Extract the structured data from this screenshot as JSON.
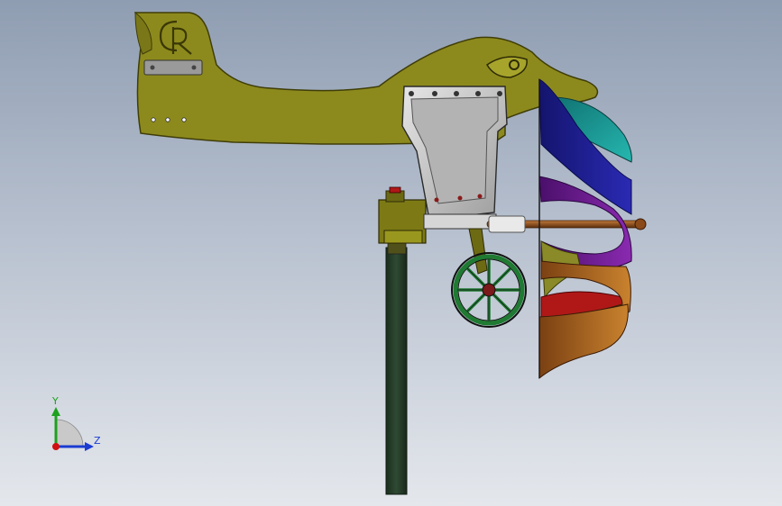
{
  "viewport": {
    "background_top": "#8f9db2",
    "background_bottom": "#e4e7ec"
  },
  "model": {
    "parts": [
      "weathervane-body",
      "logo-emblem",
      "tail-hinge-plate",
      "mounting-bracket",
      "pole",
      "generator-housing",
      "shaft",
      "spoked-wheel",
      "helical-rotor-blades"
    ],
    "colors": {
      "body": "#8d8a1d",
      "body_dark": "#5e5c10",
      "bracket": "#c9c9c9",
      "pole": "#223a26",
      "wheel": "#1f7a32",
      "blade_blue": "#1a1a8c",
      "blade_teal": "#1a9a9a",
      "blade_purple": "#6a1a8a",
      "blade_olive": "#8a8a28",
      "blade_red": "#b01818",
      "blade_orange": "#b06a20",
      "shaft": "#8a4a1a"
    }
  },
  "triad": {
    "x_label": "Z",
    "y_label": "Y",
    "x_color": "#1b3bd1",
    "y_color": "#1ea11e",
    "origin_color": "#d01010"
  }
}
